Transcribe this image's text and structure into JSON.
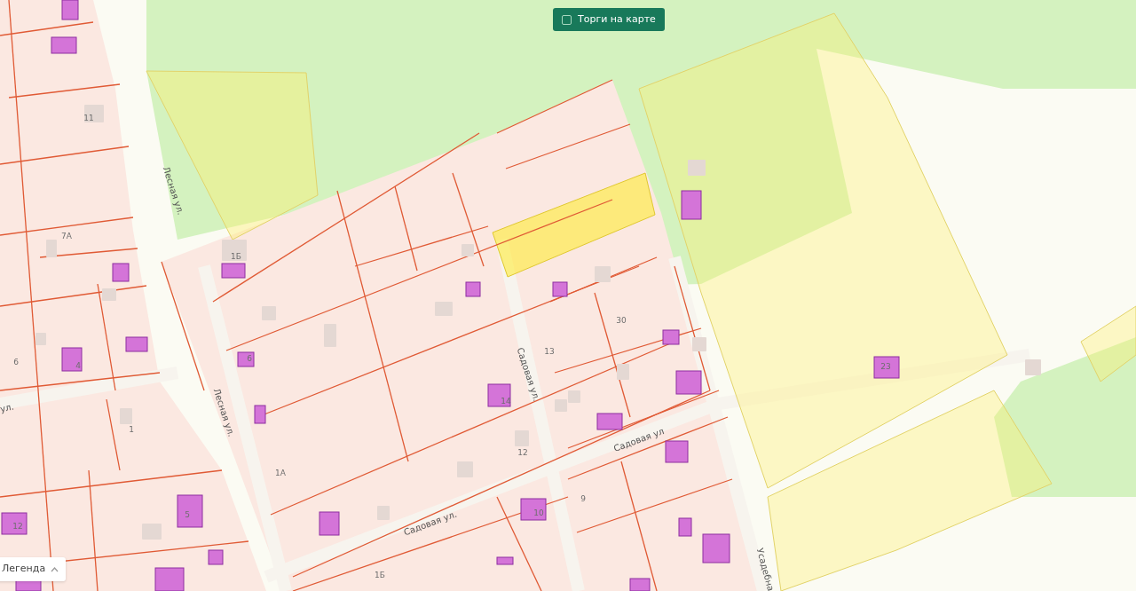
{
  "map_toggle": {
    "label": "Торги на карте",
    "checked": false
  },
  "street_labels": [
    "Лесная ул.",
    "Лесная ул.",
    "Садовая ул.",
    "Садовая ул.",
    "Садовая ул",
    "ул.",
    "Усадебна"
  ],
  "house_numbers": [
    "11",
    "7А",
    "6",
    "4",
    "1",
    "12",
    "5",
    "1Б",
    "6",
    "1А",
    "14",
    "12",
    "13",
    "30",
    "9",
    "10",
    "1Б",
    "23"
  ],
  "legend": {
    "label": "Легенда",
    "expanded": false
  }
}
